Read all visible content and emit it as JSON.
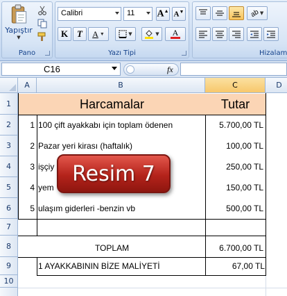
{
  "ribbon": {
    "clipboard": {
      "label": "Pano",
      "paste_label": "Yapıştır"
    },
    "font": {
      "label": "Yazı Tipi",
      "family": "Calibri",
      "size": "11",
      "bold": "K",
      "italic": "T",
      "underline": "A"
    },
    "alignment": {
      "label": "Hizalam"
    }
  },
  "formula_bar": {
    "name_box": "C16",
    "fx": "fx"
  },
  "columns": [
    "A",
    "B",
    "C",
    "D"
  ],
  "rows": [
    "1",
    "2",
    "3",
    "4",
    "5",
    "6",
    "7",
    "8",
    "9",
    "10"
  ],
  "table": {
    "header": {
      "title": "Harcamalar",
      "amount": "Tutar"
    },
    "items": [
      {
        "no": "1",
        "desc": "100 çift ayakkabı için toplam ödenen",
        "amount": "5.700,00 TL"
      },
      {
        "no": "2",
        "desc": "Pazar yeri kirası (haftalık)",
        "amount": "100,00 TL"
      },
      {
        "no": "3",
        "desc": "işçiy",
        "amount": "250,00 TL"
      },
      {
        "no": "4",
        "desc": "yem",
        "amount": "150,00 TL"
      },
      {
        "no": "5",
        "desc": "ulaşım giderleri -benzin vb",
        "amount": "500,00 TL"
      }
    ],
    "total": {
      "label": "TOPLAM",
      "amount": "6.700,00 TL"
    },
    "cost": {
      "no": "1",
      "desc": "1 AYAKKABININ BİZE MALİYETİ",
      "amount": "67,00 TL"
    }
  },
  "overlay": {
    "text": "Resim 7"
  },
  "colors": {
    "header_fill": "#fbd5b5",
    "badge": "#c0392b",
    "font_color": "#e02020",
    "ribbon_label": "#15428b"
  }
}
